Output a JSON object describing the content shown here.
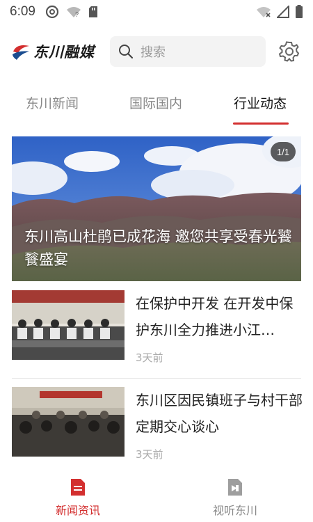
{
  "status_bar": {
    "time": "6:09"
  },
  "header": {
    "logo_text": "东川融媒",
    "search_placeholder": "搜索"
  },
  "tabs": [
    {
      "label": "东川新闻",
      "active": false
    },
    {
      "label": "国际国内",
      "active": false
    },
    {
      "label": "行业动态",
      "active": true
    }
  ],
  "hero": {
    "counter": "1/1",
    "title": "东川高山杜鹃已成花海 邀您共享受春光饕餮盛宴"
  },
  "news": [
    {
      "title": "在保护中开发 在开发中保护东川全力推进小江…",
      "time": "3天前"
    },
    {
      "title": "东川区因民镇班子与村干部定期交心谈心",
      "time": "3天前"
    }
  ],
  "bottom_nav": [
    {
      "label": "新闻资讯",
      "icon": "document-icon",
      "active": true
    },
    {
      "label": "视听东川",
      "icon": "video-icon",
      "active": false
    }
  ],
  "colors": {
    "accent": "#d32f2f",
    "inactive": "#888888"
  }
}
